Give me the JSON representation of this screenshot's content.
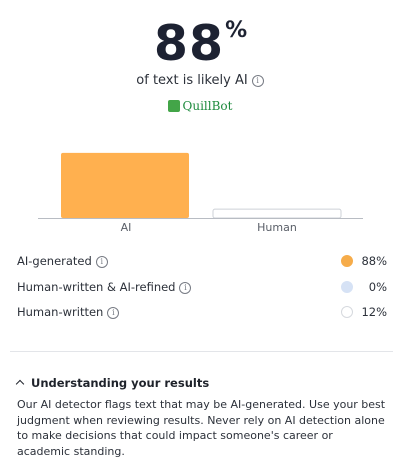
{
  "score": {
    "value": "88",
    "unit": "%",
    "subtitle": "of text is likely AI"
  },
  "brand": {
    "name": "QuillBot"
  },
  "chart_data": {
    "type": "bar",
    "categories": [
      "AI",
      "Human"
    ],
    "values": [
      88,
      12
    ],
    "colors": [
      "#ffb04f",
      "#ffffff"
    ],
    "ylim": [
      0,
      100
    ]
  },
  "legend": {
    "items": [
      {
        "label": "AI-generated",
        "percent": "88%",
        "color": "#f6ac4a",
        "border": "#f6ac4a"
      },
      {
        "label": "Human-written & AI-refined",
        "percent": "0%",
        "color": "#d6e2f5",
        "border": "#d6e2f5"
      },
      {
        "label": "Human-written",
        "percent": "12%",
        "color": "#ffffff",
        "border": "#d6d9de"
      }
    ]
  },
  "understanding": {
    "title": "Understanding your results",
    "body": "Our AI detector flags text that may be AI-generated. Use your best judgment when reviewing results. Never rely on AI detection alone to make decisions that could impact someone's career or academic standing."
  },
  "icons": {
    "info": "info-icon",
    "chevron": "chevron-up-icon",
    "logo": "quillbot-logo"
  }
}
